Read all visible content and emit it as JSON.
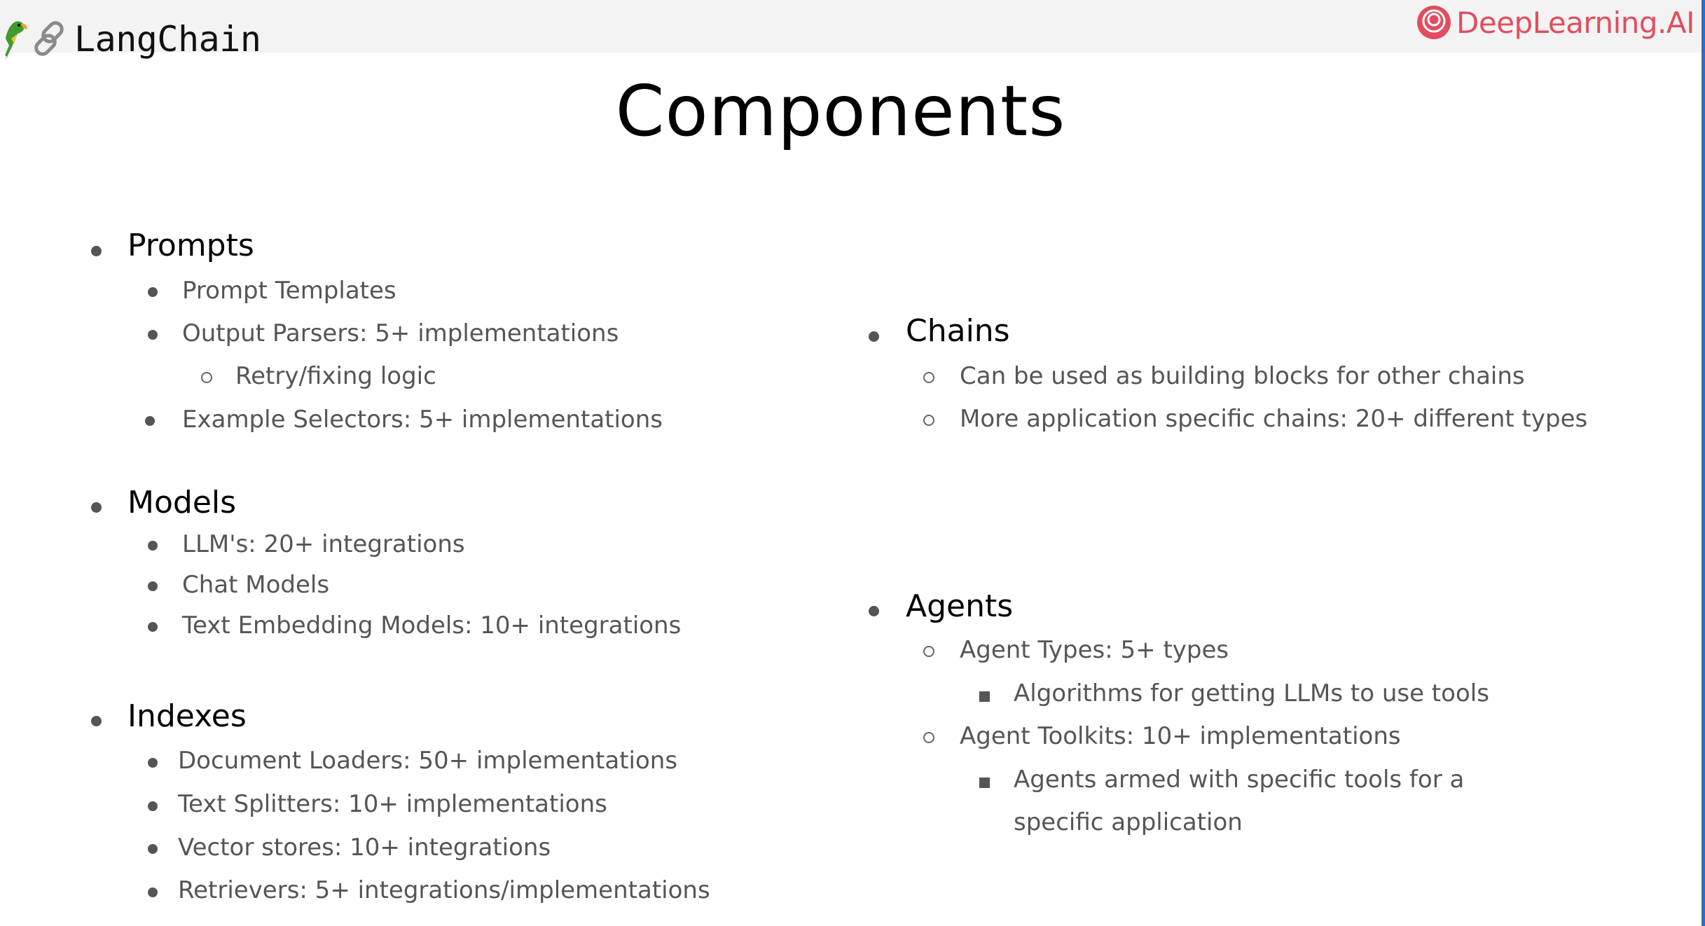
{
  "brand": {
    "left_name": "LangChain",
    "right_name": "DeepLearning.AI",
    "colors": {
      "deeplearning_red": "#e04e5e",
      "frame_blue": "#2f6fb8"
    },
    "icons": [
      "parrot-icon",
      "link-icon",
      "deeplearning-logo-icon"
    ]
  },
  "slide": {
    "title": "Components",
    "left_column": {
      "prompts": {
        "heading": "Prompts",
        "items": [
          "Prompt Templates",
          "Output Parsers: 5+ implementations",
          "Example Selectors: 5+ implementations"
        ],
        "subitem": "Retry/fixing logic"
      },
      "models": {
        "heading": "Models",
        "items": [
          "LLM's: 20+ integrations",
          "Chat Models",
          "Text Embedding Models: 10+ integrations"
        ]
      },
      "indexes": {
        "heading": "Indexes",
        "items": [
          "Document Loaders: 50+ implementations",
          "Text Splitters: 10+ implementations",
          "Vector stores: 10+ integrations",
          "Retrievers: 5+ integrations/implementations"
        ]
      }
    },
    "right_column": {
      "chains": {
        "heading": "Chains",
        "items": [
          "Can be used as building blocks for other chains",
          "More application specific chains: 20+ different types"
        ]
      },
      "agents": {
        "heading": "Agents",
        "items": [
          "Agent Types: 5+ types",
          "Agent Toolkits: 10+ implementations"
        ],
        "subitems": [
          "Algorithms for getting LLMs to use tools",
          "Agents armed with specific tools for a",
          "specific application"
        ]
      }
    }
  }
}
